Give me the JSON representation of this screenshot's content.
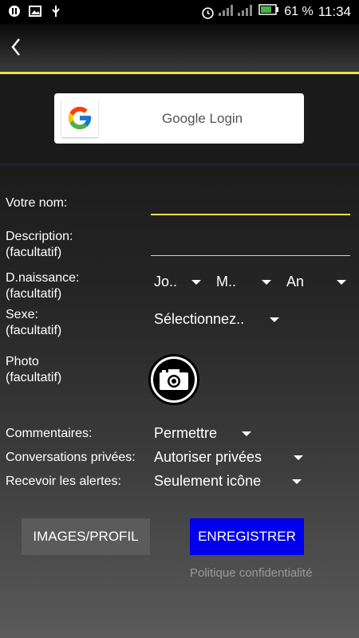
{
  "status_bar": {
    "battery_percent": "61 %",
    "time": "11:34",
    "icons": [
      "app-icon",
      "gallery-icon",
      "usb-icon",
      "alarm-icon",
      "signal-icon",
      "battery-icon"
    ]
  },
  "toolbar": {
    "back_icon": "back-chevron-icon"
  },
  "google": {
    "label": "Google Login"
  },
  "form": {
    "name_label": "Votre nom:",
    "description_label": "Description:",
    "description_optional": "(facultatif)",
    "birth_label": "D.naissance:",
    "birth_optional": "(facultatif)",
    "day": "Jo..",
    "month": "M..",
    "year": "An",
    "sex_label": "Sexe:",
    "sex_optional": "(facultatif)",
    "sex_value": "Sélectionnez..",
    "photo_label": "Photo",
    "photo_optional": "(facultatif)",
    "comments_label": "Commentaires:",
    "comments_value": "Permettre",
    "private_label": "Conversations privées:",
    "private_value": "Autoriser privées",
    "alerts_label": "Recevoir les alertes:",
    "alerts_value": "Seulement icône"
  },
  "buttons": {
    "images_profile": "IMAGES/PROFIL",
    "save": "ENREGISTRER",
    "privacy": "Politique confidentialité"
  },
  "colors": {
    "accent_yellow": "#f0e04a",
    "save_blue": "#0000ee"
  }
}
